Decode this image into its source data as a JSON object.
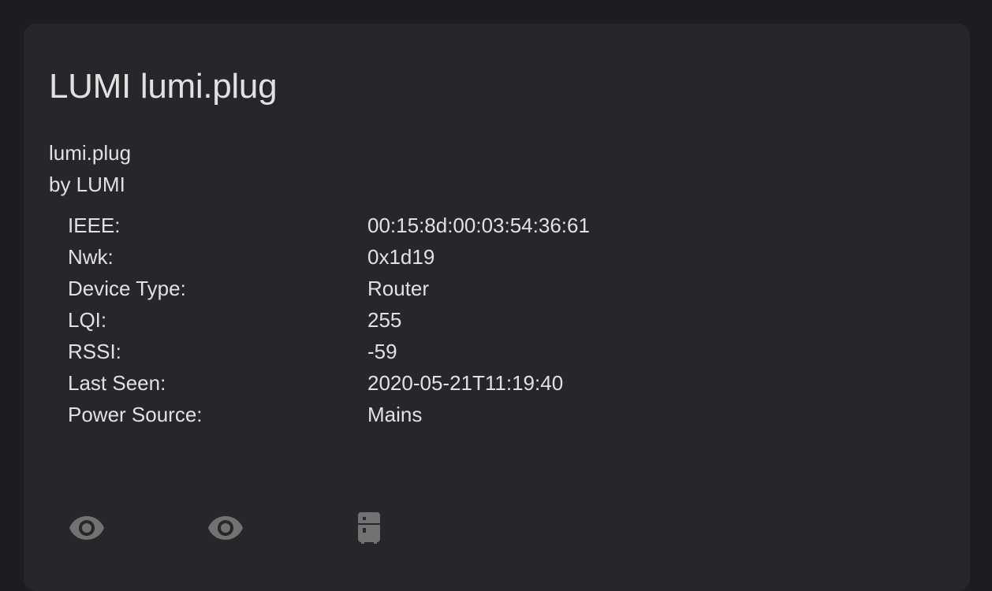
{
  "device": {
    "title": "LUMI lumi.plug",
    "model": "lumi.plug",
    "manufacturer": "by LUMI"
  },
  "info_rows": [
    {
      "label": "IEEE:",
      "value": "00:15:8d:00:03:54:36:61"
    },
    {
      "label": "Nwk:",
      "value": "0x1d19"
    },
    {
      "label": "Device Type:",
      "value": "Router"
    },
    {
      "label": "LQI:",
      "value": "255"
    },
    {
      "label": "RSSI:",
      "value": "-59"
    },
    {
      "label": "Last Seen:",
      "value": "2020-05-21T11:19:40"
    },
    {
      "label": "Power Source:",
      "value": "Mains"
    }
  ],
  "entities": [
    {
      "icon": "eye-icon"
    },
    {
      "icon": "eye-icon"
    },
    {
      "icon": "fridge-icon"
    }
  ],
  "colors": {
    "page_background": "#1c1d21",
    "card_background": "#26272b",
    "text": "#e1e1e1",
    "icon": "#727272"
  }
}
